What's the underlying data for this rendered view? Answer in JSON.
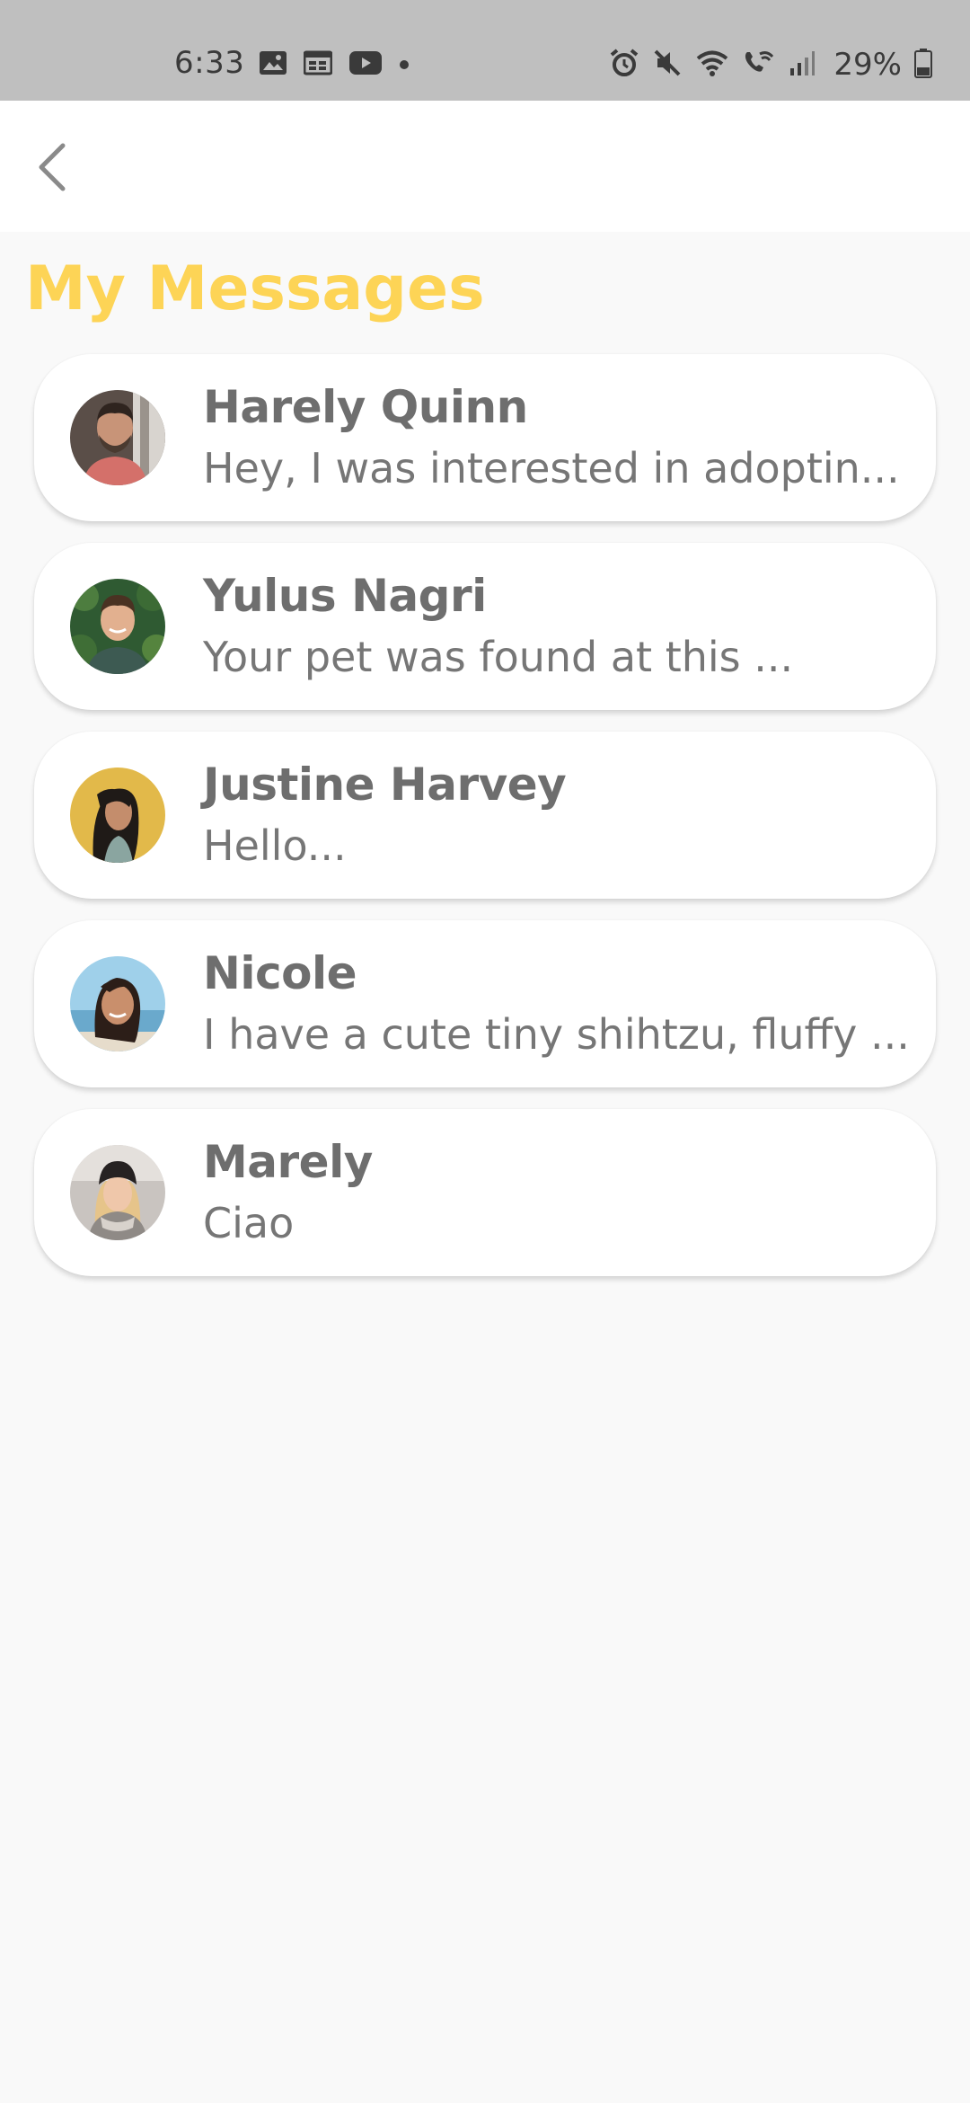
{
  "status_bar": {
    "time": "6:33",
    "battery_percent": "29%",
    "left_icons": [
      "image-icon",
      "calendar-icon",
      "youtube-icon",
      "dot-icon"
    ],
    "right_icons": [
      "alarm-icon",
      "mute-icon",
      "wifi-icon",
      "wifi-calling-icon",
      "signal-icon",
      "battery-icon"
    ]
  },
  "app_bar": {
    "back_icon": "chevron-left-icon"
  },
  "title": "My Messages",
  "colors": {
    "title": "#fdd456",
    "status_bar_bg": "#bfbfbf",
    "page_bg": "#f9f9f9"
  },
  "conversations": [
    {
      "name": "Harely Quinn",
      "preview": "Hey, I was interested in adoptin..."
    },
    {
      "name": "Yulus Nagri",
      "preview": "Your pet was found at this ..."
    },
    {
      "name": "Justine Harvey",
      "preview": "Hello..."
    },
    {
      "name": "Nicole",
      "preview": "I have a cute tiny shihtzu, fluffy ..."
    },
    {
      "name": "Marely",
      "preview": "Ciao"
    }
  ]
}
